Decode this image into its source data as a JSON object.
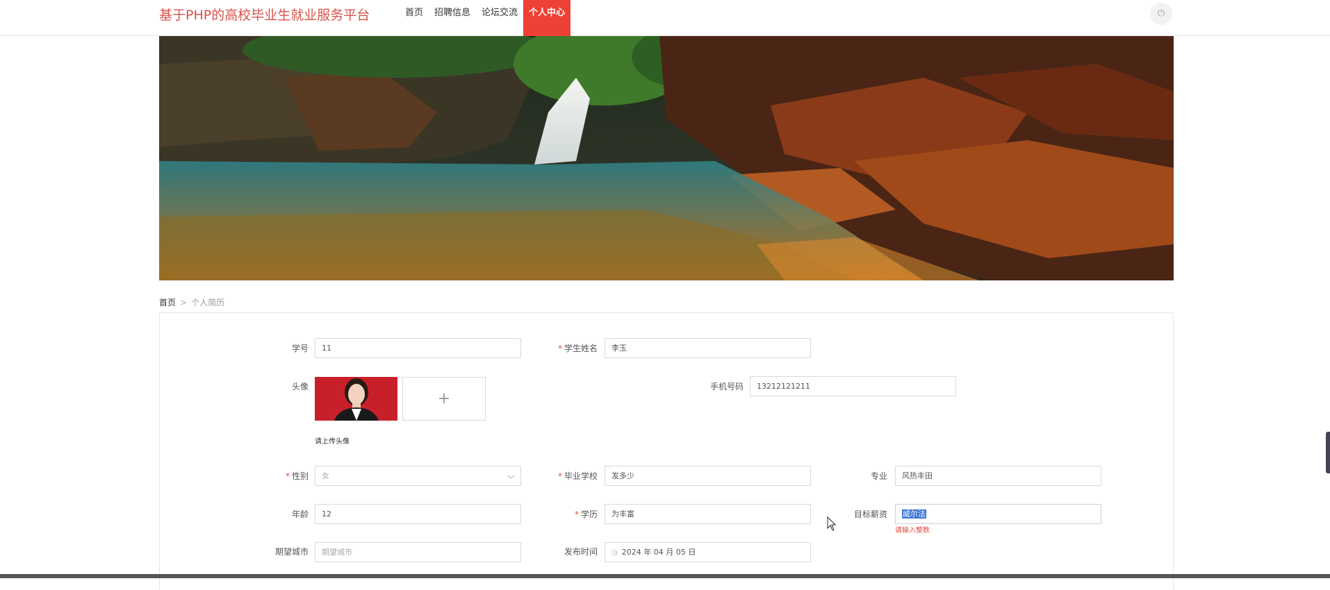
{
  "header": {
    "brand": "基于PHP的高校毕业生就业服务平台",
    "nav": [
      {
        "label": "首页"
      },
      {
        "label": "招聘信息"
      },
      {
        "label": "论坛交流"
      },
      {
        "label": "个人中心"
      }
    ],
    "power_icon": "⏻"
  },
  "breadcrumb": {
    "home": "首页",
    "separator": ">",
    "current": "个人简历"
  },
  "form": {
    "student_id": {
      "label": "学号",
      "value": "11"
    },
    "student_name": {
      "label": "学生姓名",
      "value": "李玉"
    },
    "avatar": {
      "label": "头像",
      "hint": "请上传头像",
      "upload_icon": "+"
    },
    "phone": {
      "label": "手机号码",
      "value": "13212121211"
    },
    "gender": {
      "label": "性别",
      "value": "女"
    },
    "school": {
      "label": "毕业学校",
      "value": "发多少"
    },
    "major": {
      "label": "专业",
      "value": "风热丰田"
    },
    "age": {
      "label": "年龄",
      "value": "12"
    },
    "education": {
      "label": "学历",
      "value": "为丰富"
    },
    "salary": {
      "label": "目标薪资",
      "value": "威尔法",
      "error": "请输入整数"
    },
    "city": {
      "label": "期望城市",
      "placeholder": "期望城市"
    },
    "publish_time": {
      "label": "发布时间",
      "value": "2024 年 04 月 05 日"
    }
  }
}
